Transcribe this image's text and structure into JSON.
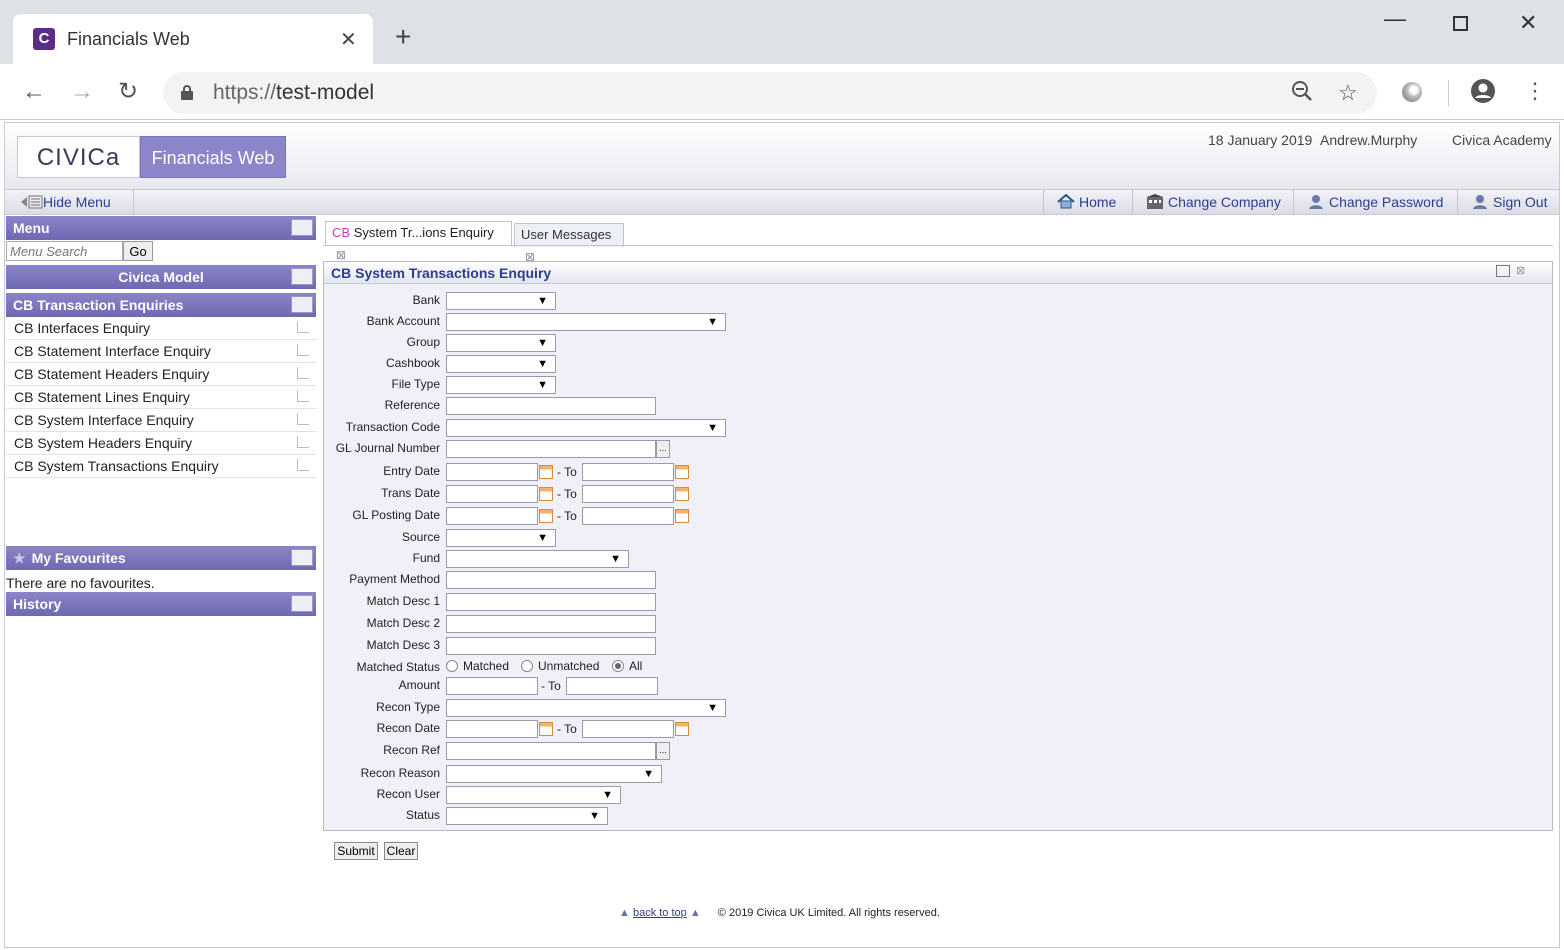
{
  "browser": {
    "tab_title": "Financials Web",
    "favicon_letter": "C",
    "url_scheme": "https://",
    "url_host": "test-model"
  },
  "header": {
    "logo_civica": "CIVICa",
    "logo_product": "Financials Web",
    "date": "18 January 2019",
    "user": "Andrew.Murphy",
    "company": "Civica Academy"
  },
  "topnav": {
    "hide_menu": "Hide Menu",
    "home": "Home",
    "change_company": "Change Company",
    "change_password": "Change Password",
    "sign_out": "Sign Out"
  },
  "menu": {
    "title": "Menu",
    "search_placeholder": "Menu Search",
    "go": "Go",
    "model": "Civica Model",
    "section": "CB Transaction Enquiries",
    "items": [
      "CB Interfaces Enquiry",
      "CB Statement Interface Enquiry",
      "CB Statement Headers Enquiry",
      "CB Statement Lines Enquiry",
      "CB System Interface Enquiry",
      "CB System Headers Enquiry",
      "CB System Transactions Enquiry"
    ],
    "favourites_title": "My Favourites",
    "favourites_empty": "There are no favourites.",
    "history_title": "History"
  },
  "tabs": {
    "active_prefix": "CB",
    "active_label": "System Tr...ions Enquiry",
    "second_label": "User Messages"
  },
  "form": {
    "title": "CB System Transactions Enquiry",
    "labels": {
      "bank": "Bank",
      "bank_account": "Bank Account",
      "group": "Group",
      "cashbook": "Cashbook",
      "file_type": "File Type",
      "reference": "Reference",
      "transaction_code": "Transaction Code",
      "gl_journal_number": "GL Journal Number",
      "entry_date": "Entry Date",
      "trans_date": "Trans Date",
      "gl_posting_date": "GL Posting Date",
      "source": "Source",
      "fund": "Fund",
      "payment_method": "Payment Method",
      "match_desc_1": "Match Desc 1",
      "match_desc_2": "Match Desc 2",
      "match_desc_3": "Match Desc 3",
      "matched_status": "Matched Status",
      "amount": "Amount",
      "recon_type": "Recon Type",
      "recon_date": "Recon Date",
      "recon_ref": "Recon Ref",
      "recon_reason": "Recon Reason",
      "recon_user": "Recon User",
      "status": "Status"
    },
    "to": "- To",
    "lookup": "...",
    "radios": {
      "matched": "Matched",
      "unmatched": "Unmatched",
      "all": "All",
      "selected": "All"
    },
    "submit": "Submit",
    "clear": "Clear"
  },
  "footer": {
    "back_to_top": "back to top",
    "copyright": "© 2019 Civica UK Limited. All rights reserved."
  }
}
